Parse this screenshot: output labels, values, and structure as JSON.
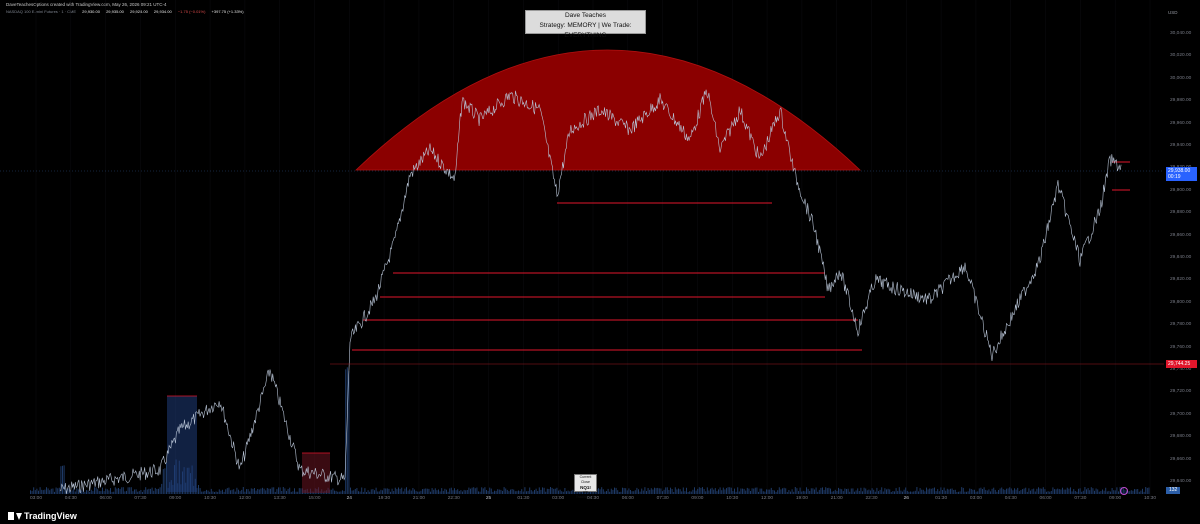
{
  "header": {
    "attribution": "DaveTeachesOptions created with TradingView.com, May 26, 2026 09:21 UTC-4",
    "symbol_line": "NASDAQ 100 E-mini Futures · 1 · CME",
    "ohlc": {
      "o": "29,930.00",
      "h": "29,935.00",
      "l": "29,928.00",
      "c": "29,934.00"
    },
    "change": "−1.75 (−0.01%)",
    "volume_change": "+397.75 (+1.33%)"
  },
  "title_box": {
    "line1": "Dave Teaches",
    "line2": "Strategy: MEMORY | We Trade: EVERYTHING"
  },
  "price_axis": {
    "unit": "USD",
    "ticks": [
      "30,040.00",
      "30,020.00",
      "30,000.00",
      "29,980.00",
      "29,960.00",
      "29,940.00",
      "29,920.00",
      "29,900.00",
      "29,880.00",
      "29,860.00",
      "29,840.00",
      "29,820.00",
      "29,800.00",
      "29,780.00",
      "29,760.00",
      "29,740.00",
      "29,720.00",
      "29,700.00",
      "29,680.00",
      "29,660.00",
      "29,640.00"
    ],
    "current_price": "29,938.00",
    "countdown": "00:19",
    "current_color": "#2962ff",
    "alert_price": "29,744.25",
    "alert_color": "#e0162b",
    "volume_badge": "132"
  },
  "time_axis": {
    "ticks": [
      {
        "label": "03:00",
        "day": false
      },
      {
        "label": "04:30",
        "day": false
      },
      {
        "label": "06:00",
        "day": false
      },
      {
        "label": "07:30",
        "day": false
      },
      {
        "label": "09:00",
        "day": false
      },
      {
        "label": "10:30",
        "day": false
      },
      {
        "label": "12:00",
        "day": false
      },
      {
        "label": "13:30",
        "day": false
      },
      {
        "label": "15:00",
        "day": false
      },
      {
        "label": "24",
        "day": true
      },
      {
        "label": "19:30",
        "day": false
      },
      {
        "label": "21:00",
        "day": false
      },
      {
        "label": "22:30",
        "day": false
      },
      {
        "label": "25",
        "day": true
      },
      {
        "label": "01:30",
        "day": false
      },
      {
        "label": "03:00",
        "day": false
      },
      {
        "label": "04:30",
        "day": false
      },
      {
        "label": "06:00",
        "day": false
      },
      {
        "label": "07:30",
        "day": false
      },
      {
        "label": "09:00",
        "day": false
      },
      {
        "label": "10:30",
        "day": false
      },
      {
        "label": "12:00",
        "day": false
      },
      {
        "label": "19:00",
        "day": false
      },
      {
        "label": "21:00",
        "day": false
      },
      {
        "label": "22:30",
        "day": false
      },
      {
        "label": "26",
        "day": true
      },
      {
        "label": "01:30",
        "day": false
      },
      {
        "label": "03:00",
        "day": false
      },
      {
        "label": "04:30",
        "day": false
      },
      {
        "label": "06:00",
        "day": false
      },
      {
        "label": "07:30",
        "day": false
      },
      {
        "label": "09:00",
        "day": false
      },
      {
        "label": "10:30",
        "day": false
      }
    ]
  },
  "session_marker": {
    "line1": "Current Close",
    "line2": "NQ1!",
    "line3": "via TradingView"
  },
  "footer": {
    "brand": "TradingView"
  },
  "colors": {
    "dome_fill": "#8b0000",
    "dome_edge": "#b01010",
    "level_line": "#e0162b",
    "price_line": "#b8c4d6",
    "volume": "#1e3a66"
  }
}
